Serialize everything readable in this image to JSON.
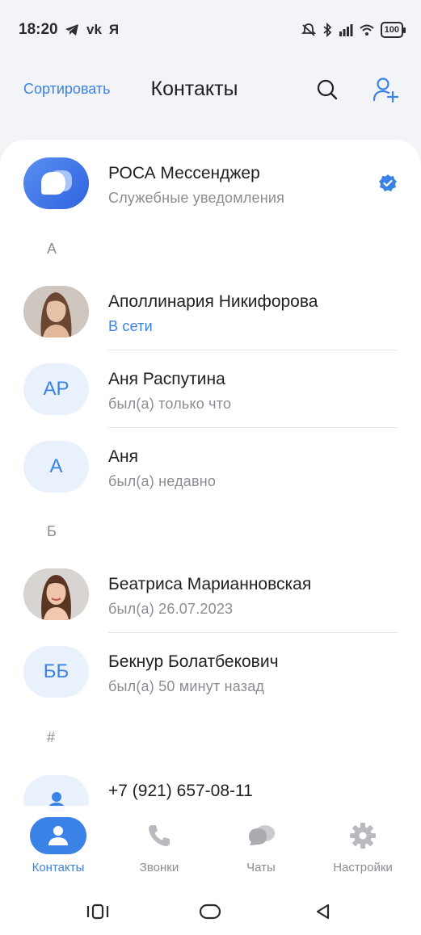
{
  "status_bar": {
    "time": "18:20",
    "left_icons": [
      "telegram-icon",
      "vk-icon",
      "yandex-icon"
    ],
    "vk_text": "vk",
    "yandex_text": "Я",
    "battery": "100",
    "right_icons": [
      "silent-icon",
      "bluetooth-icon",
      "signal-icon",
      "wifi-icon",
      "battery-icon"
    ]
  },
  "header": {
    "sort_label": "Сортировать",
    "title": "Контакты"
  },
  "colors": {
    "accent": "#3b82e6",
    "background": "#f3f4f8",
    "secondary_text": "#8b8d94"
  },
  "contacts": {
    "pinned": {
      "name": "РОСА Мессенджер",
      "status": "Служебные уведомления",
      "verified": true
    },
    "sections": [
      {
        "letter": "А",
        "items": [
          {
            "name": "Аполлинария Никифорова",
            "status": "В сети",
            "avatar": "photo",
            "online": true
          },
          {
            "name": "Аня Распутина",
            "status": "был(а) только что",
            "avatar": "initials",
            "initials": "АР"
          },
          {
            "name": "Аня",
            "status": "был(а) недавно",
            "avatar": "initials",
            "initials": "А"
          }
        ]
      },
      {
        "letter": "Б",
        "items": [
          {
            "name": "Беатриса Марианновская",
            "status": "был(а) 26.07.2023",
            "avatar": "photo"
          },
          {
            "name": "Бекнур Болатбекович",
            "status": "был(а) 50 минут назад",
            "avatar": "initials",
            "initials": "ББ"
          }
        ]
      },
      {
        "letter": "#",
        "items": [
          {
            "name": "+7 (921) 657-08-11",
            "avatar": "person-icon"
          }
        ]
      }
    ]
  },
  "bottom_nav": [
    {
      "label": "Контакты",
      "icon": "contacts-icon",
      "active": true
    },
    {
      "label": "Звонки",
      "icon": "phone-icon",
      "active": false
    },
    {
      "label": "Чаты",
      "icon": "chats-icon",
      "active": false
    },
    {
      "label": "Настройки",
      "icon": "gear-icon",
      "active": false
    }
  ],
  "system_nav": [
    "recents-icon",
    "home-icon",
    "back-icon"
  ]
}
